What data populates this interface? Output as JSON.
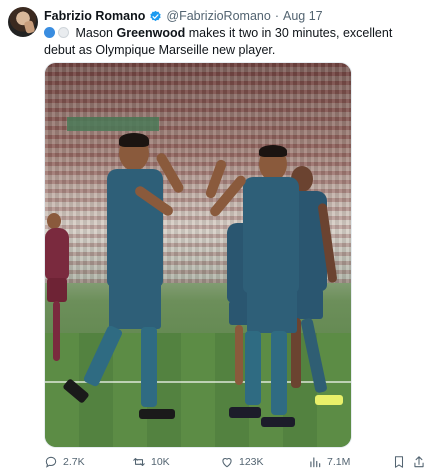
{
  "tweet": {
    "author_name": "Fabrizio Romano",
    "author_handle": "@FabrizioRomano",
    "separator": "·",
    "date": "Aug 17",
    "text_before": "Mason ",
    "text_bold": "Greenwood",
    "text_after": " makes it two in 30 minutes, excellent debut as Olympique Marseille new player.",
    "media_alt": "Photo of players celebrating"
  },
  "actions": {
    "replies": "2.7K",
    "retweets": "10K",
    "likes": "123K",
    "views": "7.1M"
  },
  "colors": {
    "verified": "#1d9bf0",
    "text_secondary": "#536471"
  },
  "icons": [
    "verified-badge-icon",
    "more-icon",
    "reply-icon",
    "retweet-icon",
    "like-icon",
    "views-icon",
    "bookmark-icon",
    "share-icon"
  ]
}
